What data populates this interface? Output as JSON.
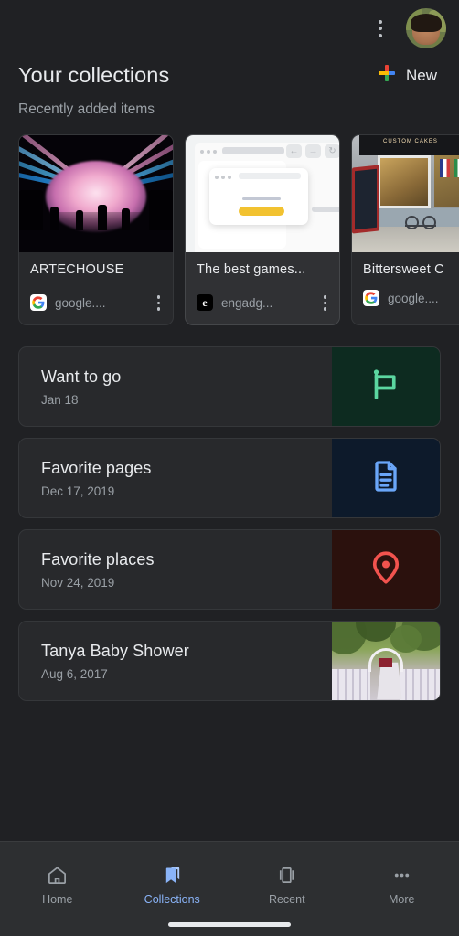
{
  "theme": {
    "background": "#202124",
    "card_bg": "#28292c",
    "card_bg_elevated": "#303134",
    "nav_bg": "#2d2f31",
    "text_primary": "#e8eaed",
    "text_secondary": "#9aa0a6",
    "accent_blue": "#8ab4f8",
    "google_blue": "#4285F4",
    "google_red": "#EA4335",
    "google_yellow": "#FBBC05",
    "google_green": "#34A853",
    "tile_green_bg": "#0d2b20",
    "tile_green_fg": "#5bd6a0",
    "tile_navy_bg": "#0d1a2b",
    "tile_navy_fg": "#6aa6f8",
    "tile_maroon_bg": "#2b110d",
    "tile_maroon_fg": "#f2534e"
  },
  "topbar": {
    "overflow_icon": "more-vert-icon",
    "avatar_icon": "avatar"
  },
  "header": {
    "title": "Your collections",
    "subtitle": "Recently added items",
    "new_button": {
      "label": "New",
      "icon": "plus-icon"
    }
  },
  "recent_cards": [
    {
      "title": "ARTECHOUSE",
      "domain": "google....",
      "favicon": "google-favicon",
      "thumbnail": "artechouse-photo",
      "menu_icon": "more-vert-icon",
      "elevated": false
    },
    {
      "title": "The best games...",
      "domain": "engadg...",
      "favicon": "engadget-favicon",
      "thumbnail": "browser-illustration",
      "menu_icon": "more-vert-icon",
      "elevated": true
    },
    {
      "title": "Bittersweet C",
      "domain": "google....",
      "favicon": "google-favicon",
      "thumbnail": "storefront-photo",
      "menu_icon": "more-vert-icon",
      "elevated": false
    }
  ],
  "collections": [
    {
      "name": "Want to go",
      "date": "Jan 18",
      "tile_type": "icon",
      "icon": "flag-icon",
      "tile_bg": "#0d2b20",
      "icon_color": "#5bd6a0"
    },
    {
      "name": "Favorite pages",
      "date": "Dec 17, 2019",
      "tile_type": "icon",
      "icon": "document-icon",
      "tile_bg": "#0d1a2b",
      "icon_color": "#6aa6f8"
    },
    {
      "name": "Favorite places",
      "date": "Nov 24, 2019",
      "tile_type": "icon",
      "icon": "location-pin-icon",
      "tile_bg": "#2b110d",
      "icon_color": "#f2534e"
    },
    {
      "name": "Tanya Baby Shower",
      "date": "Aug 6, 2017",
      "tile_type": "photo",
      "icon": "baby-shower-photo",
      "tile_bg": "#6f8a45",
      "icon_color": ""
    }
  ],
  "bottom_nav": {
    "items": [
      {
        "label": "Home",
        "icon": "home-icon",
        "active": false
      },
      {
        "label": "Collections",
        "icon": "bookmark-icon",
        "active": true
      },
      {
        "label": "Recent",
        "icon": "recent-tabs-icon",
        "active": false
      },
      {
        "label": "More",
        "icon": "more-horiz-icon",
        "active": false
      }
    ]
  }
}
